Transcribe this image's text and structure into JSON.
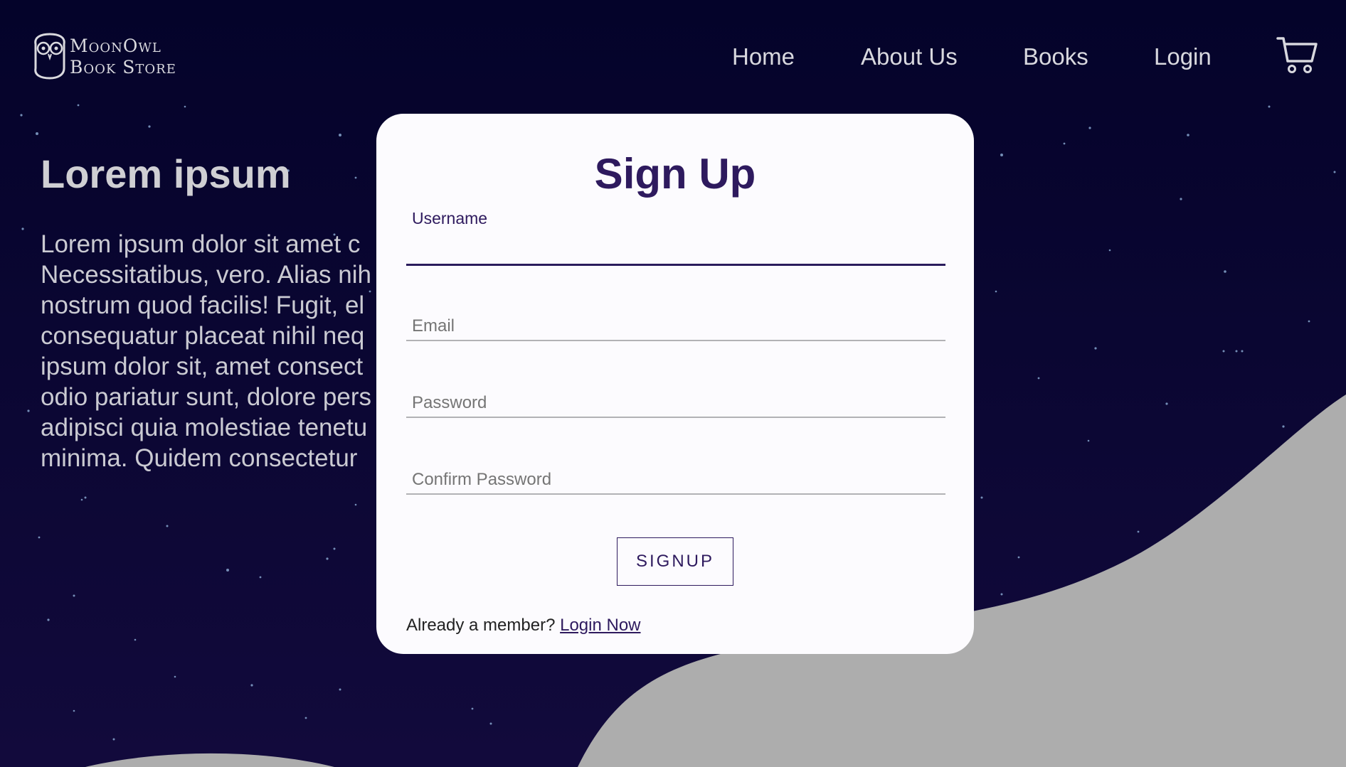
{
  "brand": {
    "logo_line1": "MoonOwl",
    "logo_line2": "Book Store",
    "logo_icon": "owl-icon"
  },
  "nav": {
    "home": "Home",
    "about": "About Us",
    "books": "Books",
    "login": "Login",
    "cart_icon": "cart-icon"
  },
  "hero": {
    "title": "Lorem ipsum",
    "body": "Lorem ipsum dolor sit amet c\nNecessitatibus, vero. Alias nih\nnostrum quod facilis! Fugit, el\nconsequatur placeat nihil neq\nipsum dolor sit, amet consect\nodio pariatur sunt, dolore pers\nadipisci quia molestiae tenetu\nminima. Quidem consectetur"
  },
  "form": {
    "title": "Sign Up",
    "username_label": "Username",
    "username_value": "",
    "email_placeholder": "Email",
    "password_placeholder": "Password",
    "confirm_placeholder": "Confirm Password",
    "submit_label": "SIGNUP",
    "member_text": "Already a member?",
    "login_link": "Login Now"
  },
  "colors": {
    "background": "#05042a",
    "accent": "#2e1a5e",
    "hill": "#adadad",
    "card": "#fcfbfe"
  }
}
